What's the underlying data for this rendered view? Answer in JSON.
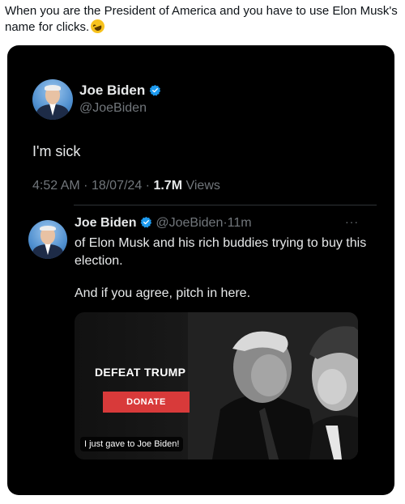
{
  "caption": {
    "text": "When you are the President of America and you have to use Elon Musk's name for clicks.",
    "emoji_icon": "rolling-on-floor-laughing-emoji"
  },
  "tweet": {
    "author_name": "Joe Biden",
    "handle": "@JoeBiden",
    "verified_icon": "verified-badge-icon",
    "text": "I'm sick",
    "time": "4:52 AM",
    "date": "18/07/24",
    "views_count": "1.7M",
    "views_label": "Views",
    "separator": "·"
  },
  "quoted": {
    "author_name": "Joe Biden",
    "handle": "@JoeBiden",
    "age": "11m",
    "separator": "·",
    "more_icon": "more-dots-icon",
    "more_text": "···",
    "text_line1": "of Elon Musk and his rich buddies trying to buy this election.",
    "text_line2": "And if you agree, pitch in here.",
    "media": {
      "title": "DEFEAT TRUMP",
      "button_label": "DONATE",
      "caption": "I just gave to Joe Biden!"
    }
  },
  "colors": {
    "card_bg": "#000000",
    "text_primary": "#e7e9ea",
    "text_secondary": "#71767b",
    "verified_blue": "#1d9bf0",
    "donate_red": "#d83a3a"
  }
}
